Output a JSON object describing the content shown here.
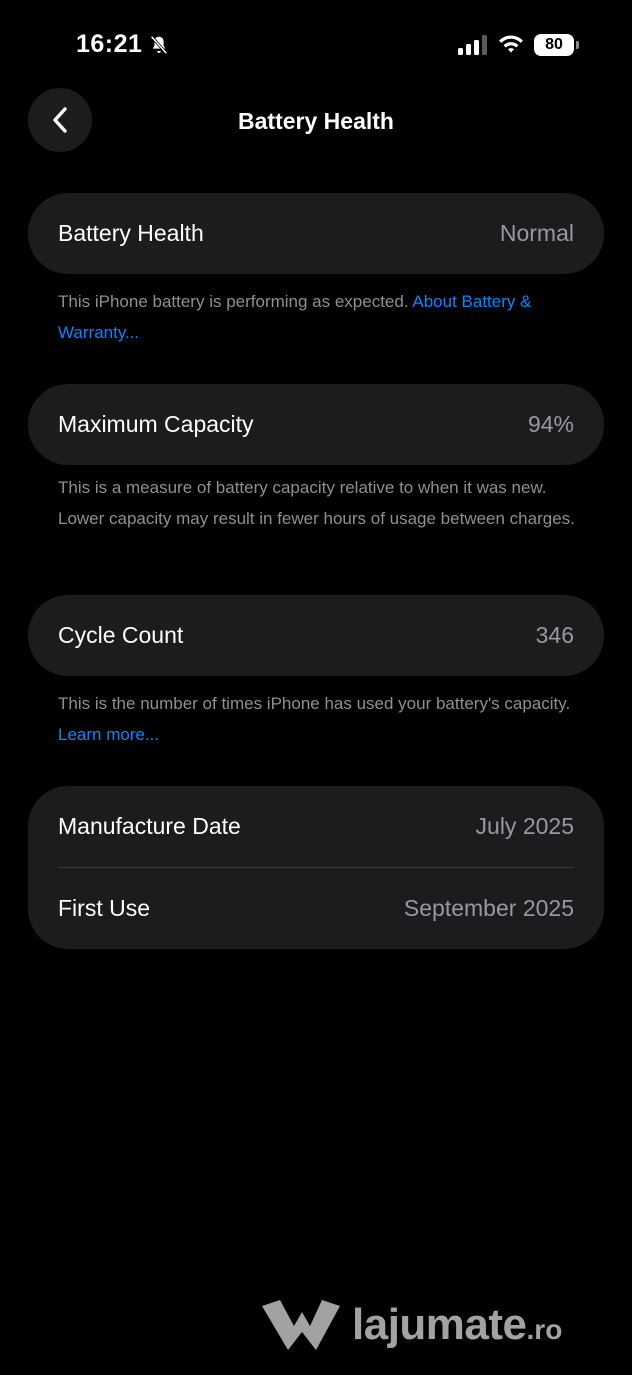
{
  "status_bar": {
    "time": "16:21",
    "battery_level": "80"
  },
  "nav": {
    "title": "Battery Health"
  },
  "battery_health": {
    "label": "Battery Health",
    "value": "Normal",
    "note": "This iPhone battery is performing as expected.",
    "link": "About Battery & Warranty..."
  },
  "maximum_capacity": {
    "label": "Maximum Capacity",
    "value": "94%",
    "note": "This is a measure of battery capacity relative to when it was new. Lower capacity may result in fewer hours of usage between charges."
  },
  "cycle_count": {
    "label": "Cycle Count",
    "value": "346",
    "note": "This is the number of times iPhone has used your battery's capacity.",
    "link": "Learn more..."
  },
  "dates": {
    "manufacture_label": "Manufacture Date",
    "manufacture_value": "July 2025",
    "first_use_label": "First Use",
    "first_use_value": "September 2025"
  },
  "watermark": {
    "brand": "lajumate",
    "suffix": ".ro"
  },
  "colors": {
    "background": "#000000",
    "card": "#1c1c1e",
    "secondary_text": "#98989f",
    "link": "#0a84ff"
  }
}
